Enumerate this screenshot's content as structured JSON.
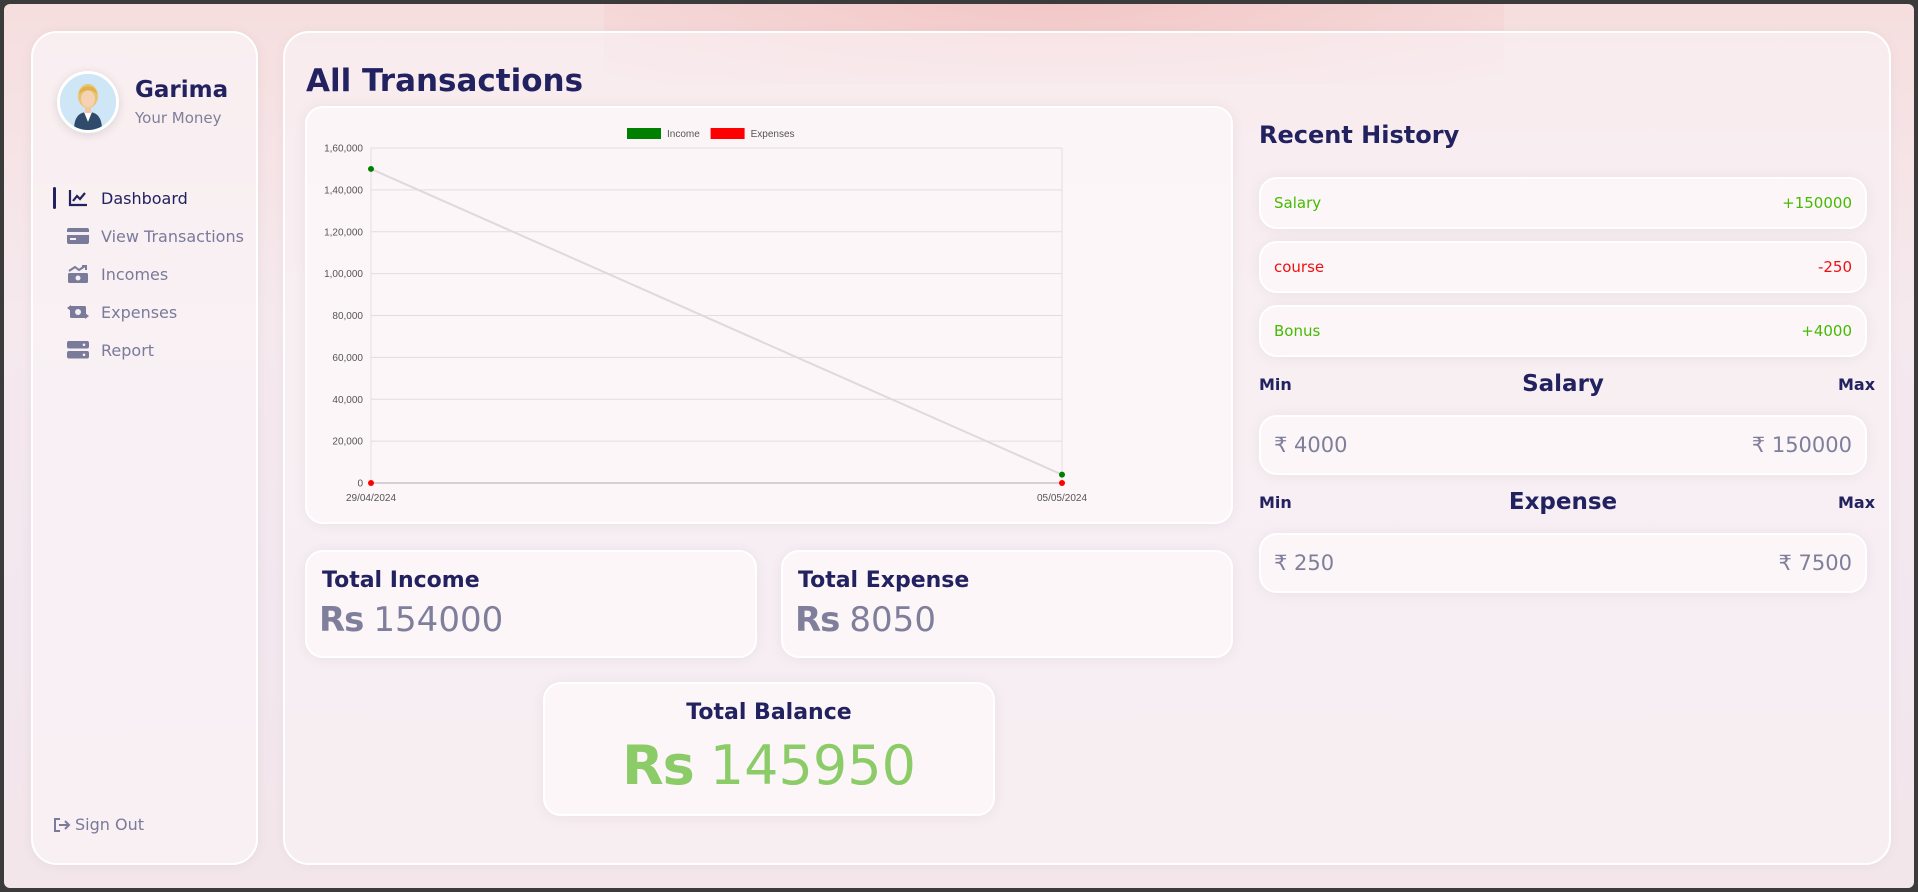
{
  "user": {
    "name": "Garima",
    "subtitle": "Your Money"
  },
  "nav": {
    "items": [
      {
        "label": "Dashboard",
        "icon": "chart-line-icon",
        "active": true
      },
      {
        "label": "View Transactions",
        "icon": "credit-card-icon",
        "active": false
      },
      {
        "label": "Incomes",
        "icon": "money-bill-trend-up-icon",
        "active": false
      },
      {
        "label": "Expenses",
        "icon": "money-bill-transfer-icon",
        "active": false
      },
      {
        "label": "Report",
        "icon": "server-icon",
        "active": false
      }
    ],
    "signout": "Sign Out"
  },
  "page": {
    "title": "All Transactions"
  },
  "chart_data": {
    "type": "line",
    "title": "",
    "xlabel": "",
    "ylabel": "",
    "categories": [
      "29/04/2024",
      "05/05/2024"
    ],
    "series": [
      {
        "name": "Income",
        "color": "#008000",
        "values": [
          150000,
          4000
        ]
      },
      {
        "name": "Expenses",
        "color": "#ff0000",
        "values": [
          0,
          0
        ]
      }
    ],
    "ylim": [
      0,
      160000
    ],
    "yticks": [
      "0",
      "20,000",
      "40,000",
      "60,000",
      "80,000",
      "1,00,000",
      "1,20,000",
      "1,40,000",
      "1,60,000"
    ],
    "grid": true,
    "legend_position": "top"
  },
  "totals": {
    "income_label": "Total Income",
    "income_currency": "Rs",
    "income_value": "154000",
    "expense_label": "Total Expense",
    "expense_currency": "Rs",
    "expense_value": "8050",
    "balance_label": "Total Balance",
    "balance_currency": "Rs",
    "balance_value": "145950"
  },
  "history": {
    "title": "Recent History",
    "items": [
      {
        "name": "Salary",
        "amount": "+150000",
        "color": "#44bb00"
      },
      {
        "name": "course",
        "amount": "-250",
        "color": "#ee1111"
      },
      {
        "name": "Bonus",
        "amount": "+4000",
        "color": "#44bb00"
      }
    ]
  },
  "salary_range": {
    "title": "Salary",
    "min_label": "Min",
    "max_label": "Max",
    "min": "₹ 4000",
    "max": "₹ 150000"
  },
  "expense_range": {
    "title": "Expense",
    "min_label": "Min",
    "max_label": "Max",
    "min": "₹ 250",
    "max": "₹ 7500"
  },
  "colors": {
    "primary": "#222260",
    "muted": "#7f7f9c",
    "balance": "#8ccc68"
  }
}
